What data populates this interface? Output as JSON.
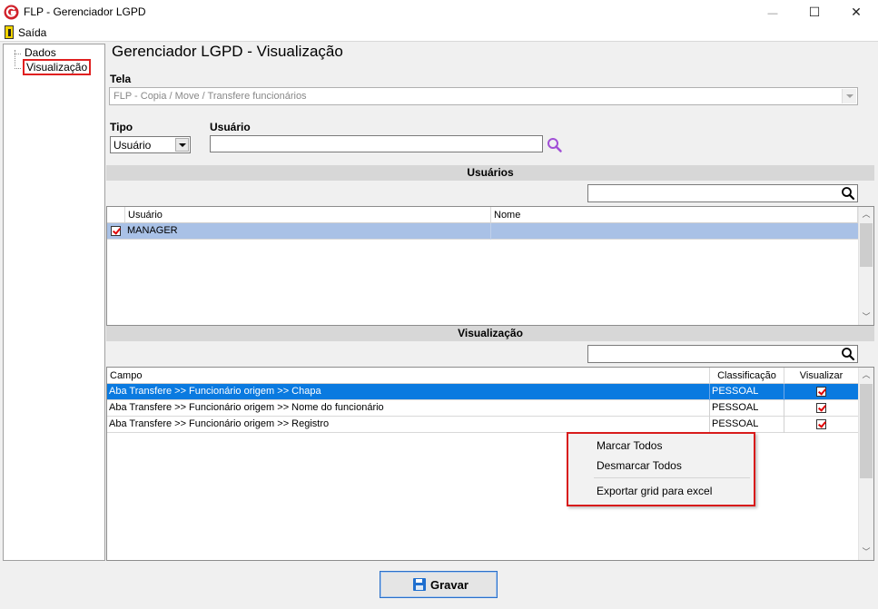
{
  "window": {
    "title": "FLP - Gerenciador LGPD",
    "minimize": "—",
    "maximize": "☐",
    "close": "✕"
  },
  "menu": {
    "exit_label": "Saída"
  },
  "tree": {
    "items": [
      {
        "label": "Dados"
      },
      {
        "label": "Visualização"
      }
    ]
  },
  "page_title": "Gerenciador LGPD - Visualização",
  "tela": {
    "label": "Tela",
    "value": "FLP - Copia / Move / Transfere funcionários"
  },
  "tipo": {
    "label": "Tipo",
    "value": "Usuário"
  },
  "usuario": {
    "label": "Usuário",
    "value": ""
  },
  "usuarios_section": {
    "header": "Usuários",
    "filter_value": "",
    "columns": [
      "Usuário",
      "Nome"
    ],
    "rows": [
      {
        "checked": true,
        "usuario": "MANAGER",
        "nome": ""
      }
    ]
  },
  "visualizacao_section": {
    "header": "Visualização",
    "filter_value": "",
    "columns": [
      "Campo",
      "Classificação",
      "Visualizar"
    ],
    "rows": [
      {
        "campo": "Aba Transfere >> Funcionário origem >> Chapa",
        "classificacao": "PESSOAL",
        "visualizar": true
      },
      {
        "campo": "Aba Transfere >> Funcionário origem >> Nome do funcionário",
        "classificacao": "PESSOAL",
        "visualizar": true
      },
      {
        "campo": "Aba Transfere >> Funcionário origem >> Registro",
        "classificacao": "PESSOAL",
        "visualizar": true
      }
    ]
  },
  "context_menu": {
    "items": [
      "Marcar Todos",
      "Desmarcar Todos",
      "Exportar grid para excel"
    ]
  },
  "save_button": {
    "label": "Gravar"
  },
  "colors": {
    "selection": "#0a7ae0",
    "highlight_border": "#d81b1b",
    "search_icon": "#a14fd6"
  },
  "icons": [
    "app-logo-icon",
    "exit-door-icon",
    "search-icon",
    "magnifier-icon",
    "checkbox-icon",
    "floppy-disk-icon"
  ]
}
